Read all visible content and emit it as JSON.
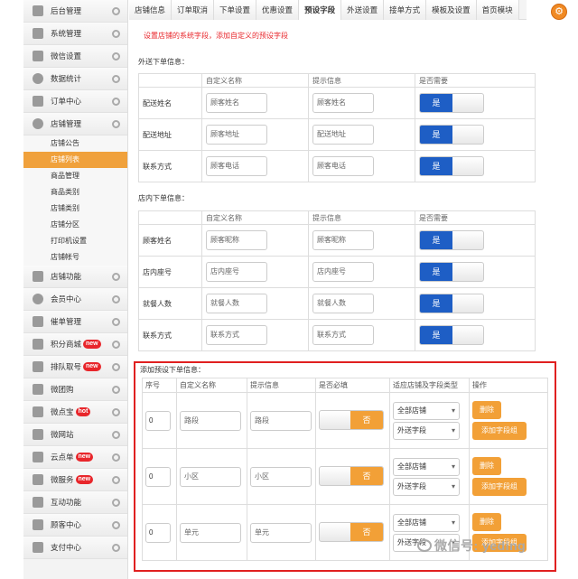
{
  "sidebar": {
    "top_items": [
      {
        "label": "后台管理",
        "icon": "grid-icon"
      },
      {
        "label": "系统管理",
        "icon": "grid-icon"
      },
      {
        "label": "微信设置",
        "icon": "mail-icon"
      },
      {
        "label": "数据统计",
        "icon": "pie-chart-icon"
      },
      {
        "label": "订单中心",
        "icon": "grid-icon"
      },
      {
        "label": "店铺管理",
        "icon": "pie-chart-icon"
      }
    ],
    "sub_items": [
      "店铺公告",
      "店铺列表",
      "商品管理",
      "商品类别",
      "店铺类别",
      "店铺分区",
      "打印机设置",
      "店铺帐号"
    ],
    "active_sub": 1,
    "bottom_items": [
      {
        "label": "店铺功能",
        "icon": "plus-icon",
        "badge": ""
      },
      {
        "label": "会员中心",
        "icon": "pie-chart-icon",
        "badge": ""
      },
      {
        "label": "催单管理",
        "icon": "grid-icon",
        "badge": ""
      },
      {
        "label": "积分商城",
        "icon": "grid-icon",
        "badge": "new"
      },
      {
        "label": "排队取号",
        "icon": "grid-icon",
        "badge": "new"
      },
      {
        "label": "微团购",
        "icon": "grid-icon",
        "badge": ""
      },
      {
        "label": "微点宝",
        "icon": "grid-icon",
        "badge": "hot"
      },
      {
        "label": "微网站",
        "icon": "grid-icon",
        "badge": ""
      },
      {
        "label": "云点单",
        "icon": "grid-icon",
        "badge": "new"
      },
      {
        "label": "微服务",
        "icon": "grid-icon",
        "badge": "new"
      },
      {
        "label": "互动功能",
        "icon": "plus-icon",
        "badge": ""
      },
      {
        "label": "顾客中心",
        "icon": "tray-icon",
        "badge": ""
      },
      {
        "label": "支付中心",
        "icon": "tray-icon",
        "badge": ""
      }
    ]
  },
  "tabs": [
    "店铺信息",
    "订单取消",
    "下单设置",
    "优惠设置",
    "预设字段",
    "外送设置",
    "接单方式",
    "模板及设置",
    "首页模块"
  ],
  "active_tab": 4,
  "notice": "设置店铺的系统字段，添加自定义的预设字段",
  "columns": {
    "custom_name": "自定义名称",
    "hint": "提示信息",
    "required": "是否需要"
  },
  "toggle_on": "是",
  "toggle_off": "否",
  "delivery": {
    "title": "外送下单信息：",
    "rows": [
      {
        "label": "配送姓名",
        "name": "顾客姓名",
        "hint": "顾客姓名"
      },
      {
        "label": "配送地址",
        "name": "顾客地址",
        "hint": "配送地址"
      },
      {
        "label": "联系方式",
        "name": "顾客电话",
        "hint": "顾客电话"
      }
    ]
  },
  "dinein": {
    "title": "店内下单信息：",
    "rows": [
      {
        "label": "顾客姓名",
        "name": "顾客昵称",
        "hint": "顾客昵称"
      },
      {
        "label": "店内座号",
        "name": "店内座号",
        "hint": "店内座号"
      },
      {
        "label": "就餐人数",
        "name": "就餐人数",
        "hint": "就餐人数"
      },
      {
        "label": "联系方式",
        "name": "联系方式",
        "hint": "联系方式"
      }
    ]
  },
  "preset": {
    "title": "添加预设下单信息：",
    "headers": [
      "序号",
      "自定义名称",
      "提示信息",
      "是否必填",
      "适应店铺及字段类型",
      "操作"
    ],
    "delete_label": "删除",
    "add_label": "添加字段组",
    "rows": [
      {
        "seq": "0",
        "name": "路段",
        "hint": "路段",
        "store": "全部店铺",
        "type": "外送字段"
      },
      {
        "seq": "0",
        "name": "小区",
        "hint": "小区",
        "store": "全部店铺",
        "type": "外送字段"
      },
      {
        "seq": "0",
        "name": "单元",
        "hint": "单元",
        "store": "全部店铺",
        "type": "外送字段"
      }
    ]
  },
  "watermark": "微信号: yeding"
}
